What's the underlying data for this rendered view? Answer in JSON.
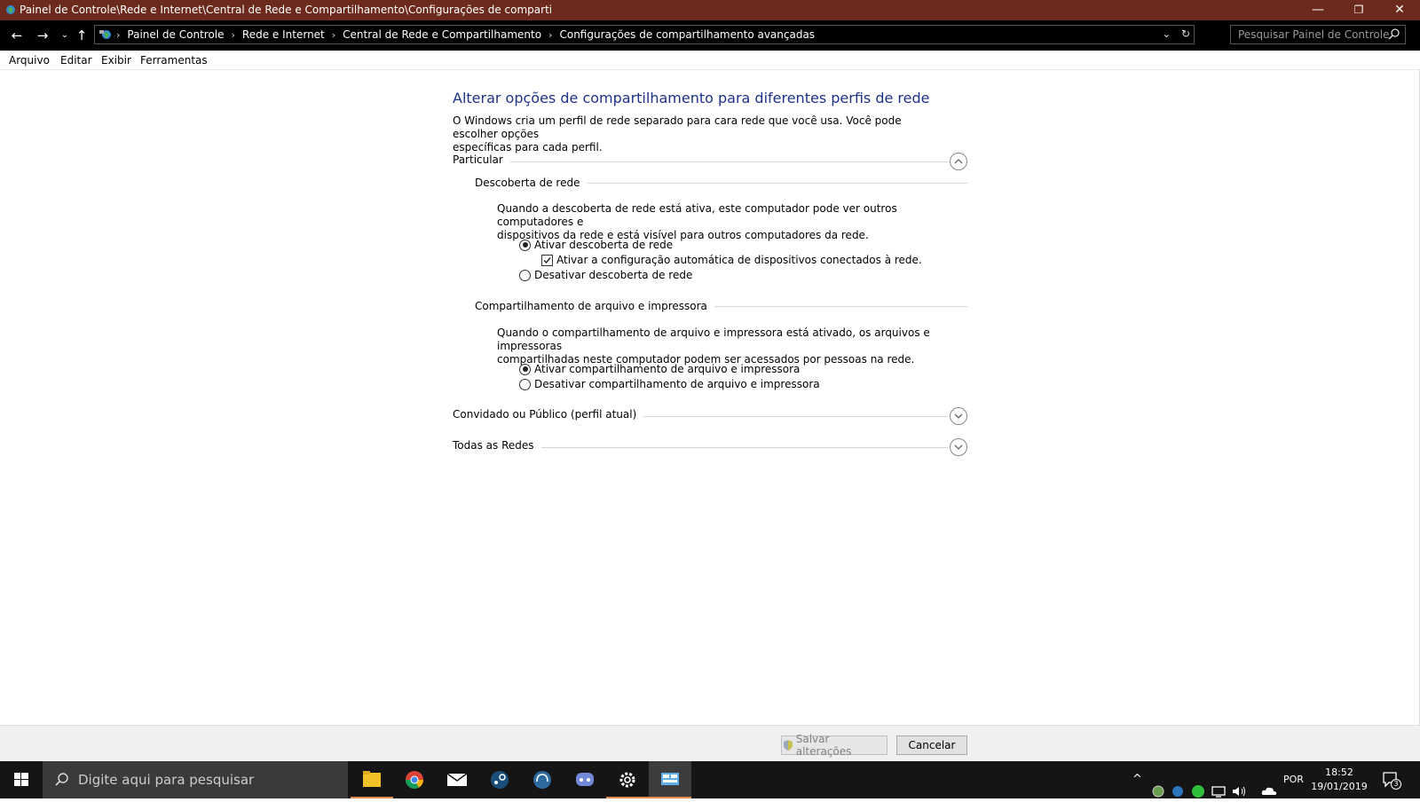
{
  "window": {
    "title": "Painel de Controle\\Rede e Internet\\Central de Rede e Compartilhamento\\Configurações de comparti",
    "minimize": "—",
    "maximize": "❐",
    "close": "✕"
  },
  "address": {
    "crumbs": [
      "Painel de Controle",
      "Rede e Internet",
      "Central de Rede e Compartilhamento",
      "Configurações de compartilhamento avançadas"
    ],
    "search_placeholder": "Pesquisar Painel de Controle"
  },
  "menu": [
    "Arquivo",
    "Editar",
    "Exibir",
    "Ferramentas"
  ],
  "content": {
    "title": "Alterar opções de compartilhamento para diferentes perfis de rede",
    "intro_line1": "O Windows cria um perfil de rede separado para cara rede que você usa. Você pode escolher opções",
    "intro_line2": "específicas para cada perfil.",
    "profile_private": "Particular",
    "discovery_heading": "Descoberta de rede",
    "discovery_desc1": "Quando a descoberta de rede está ativa, este computador pode ver outros computadores e",
    "discovery_desc2": "dispositivos da rede e está visível para outros computadores da rede.",
    "discovery_on": "Ativar descoberta de rede",
    "discovery_auto": "Ativar a configuração automática de dispositivos conectados à rede.",
    "discovery_off": "Desativar descoberta de rede",
    "sharing_heading": "Compartilhamento de arquivo e impressora",
    "sharing_desc1": "Quando o compartilhamento de arquivo e impressora está ativado, os arquivos e impressoras",
    "sharing_desc2": "compartilhadas neste computador podem ser acessados por pessoas na rede.",
    "sharing_on": "Ativar compartilhamento de arquivo e impressora",
    "sharing_off": "Desativar compartilhamento de arquivo e impressora",
    "profile_guest": "Convidado ou Público (perfil atual)",
    "profile_all": "Todas as Redes"
  },
  "footer": {
    "save": "Salvar alterações",
    "cancel": "Cancelar"
  },
  "taskbar": {
    "search_placeholder": "Digite aqui para pesquisar",
    "lang": "POR",
    "time": "18:52",
    "date": "19/01/2019",
    "notifications": "3"
  }
}
